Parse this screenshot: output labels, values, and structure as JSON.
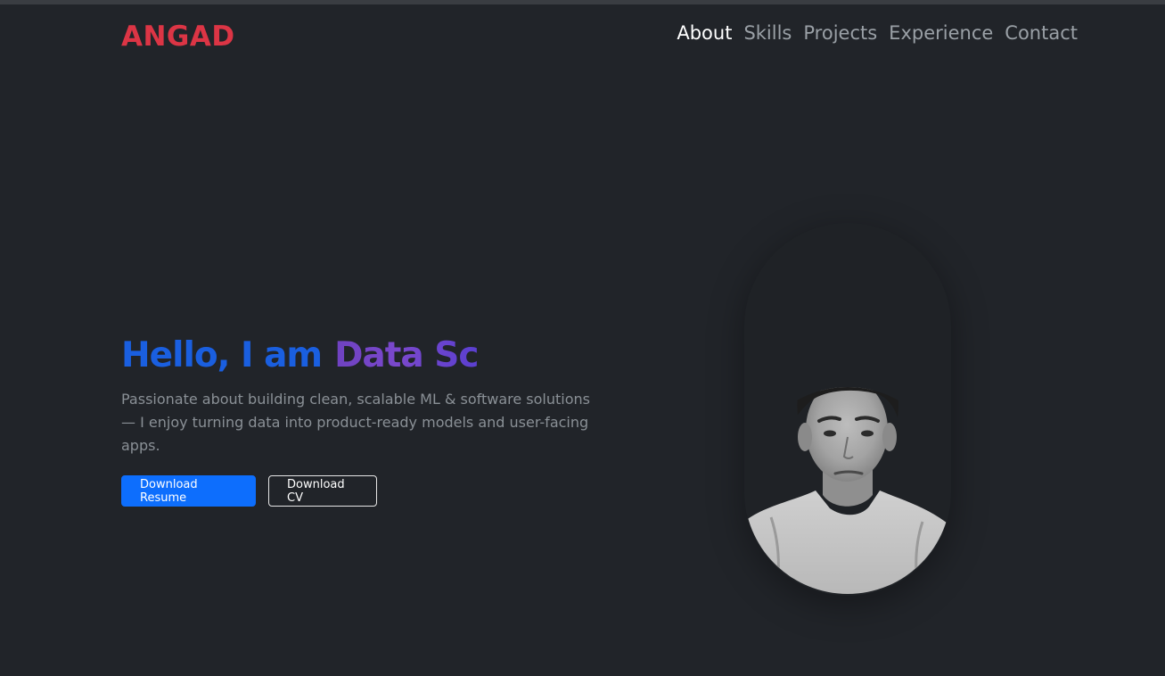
{
  "brand": {
    "name": "ANGAD",
    "color": "#dc3545"
  },
  "nav": {
    "items": [
      {
        "label": "About",
        "active": true
      },
      {
        "label": "Skills",
        "active": false
      },
      {
        "label": "Projects",
        "active": false
      },
      {
        "label": "Experience",
        "active": false
      },
      {
        "label": "Contact",
        "active": false
      }
    ]
  },
  "hero": {
    "greeting": "Hello, I am",
    "role_typing": "Data Sc",
    "description": "Passionate about building clean, scalable ML & software solutions — I enjoy turning data into product-ready models and user-facing apps.",
    "buttons": {
      "primary": "Download Resume",
      "secondary": "Download CV"
    }
  },
  "portrait": {
    "subject": "profile-photo"
  },
  "colors": {
    "background": "#212429",
    "accent_blue": "#0d6efd",
    "greeting_blue": "#1a5fe0",
    "role_purple": "#6f42c1"
  }
}
